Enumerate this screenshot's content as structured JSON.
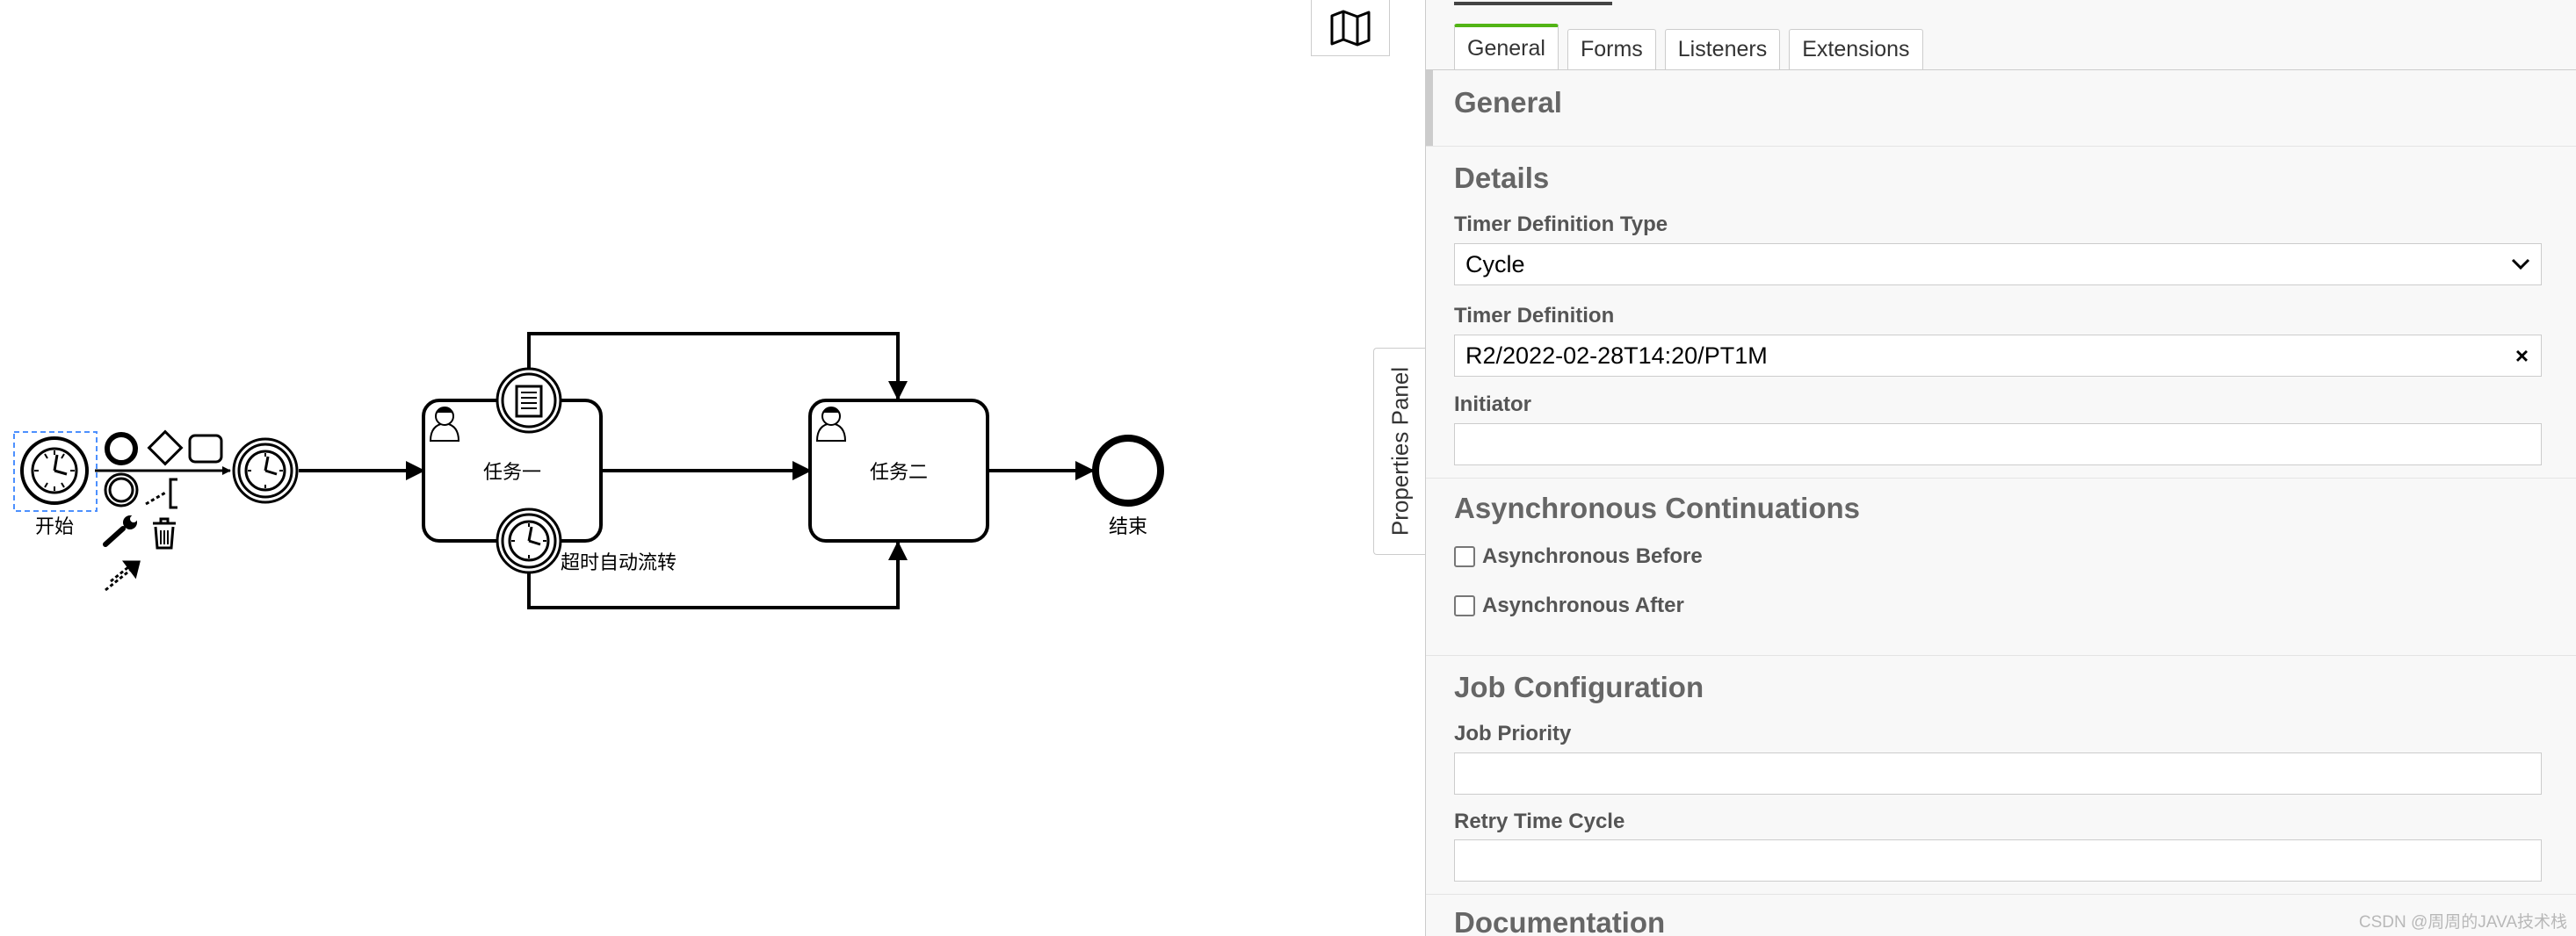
{
  "diagram": {
    "start_label": "开始",
    "task1_label": "任务一",
    "task2_label": "任务二",
    "timer_boundary_label": "超时自动流转",
    "end_label": "结束"
  },
  "panel": {
    "side_tab_label": "Properties Panel",
    "tabs": [
      "General",
      "Forms",
      "Listeners",
      "Extensions"
    ],
    "active_tab": "General",
    "general_heading": "General",
    "details_heading": "Details",
    "timer_type_label": "Timer Definition Type",
    "timer_type_value": "Cycle",
    "timer_def_label": "Timer Definition",
    "timer_def_value": "R2/2022-02-28T14:20/PT1M",
    "initiator_label": "Initiator",
    "initiator_value": "",
    "async_heading": "Asynchronous Continuations",
    "async_before_label": "Asynchronous Before",
    "async_before_checked": false,
    "async_after_label": "Asynchronous After",
    "async_after_checked": false,
    "job_heading": "Job Configuration",
    "job_priority_label": "Job Priority",
    "job_priority_value": "",
    "retry_label": "Retry Time Cycle",
    "retry_value": "",
    "documentation_heading": "Documentation"
  },
  "watermark": "CSDN @周周的JAVA技术栈",
  "colors": {
    "active_tab_accent": "#52b415",
    "selection_outline": "#4d90fe"
  }
}
